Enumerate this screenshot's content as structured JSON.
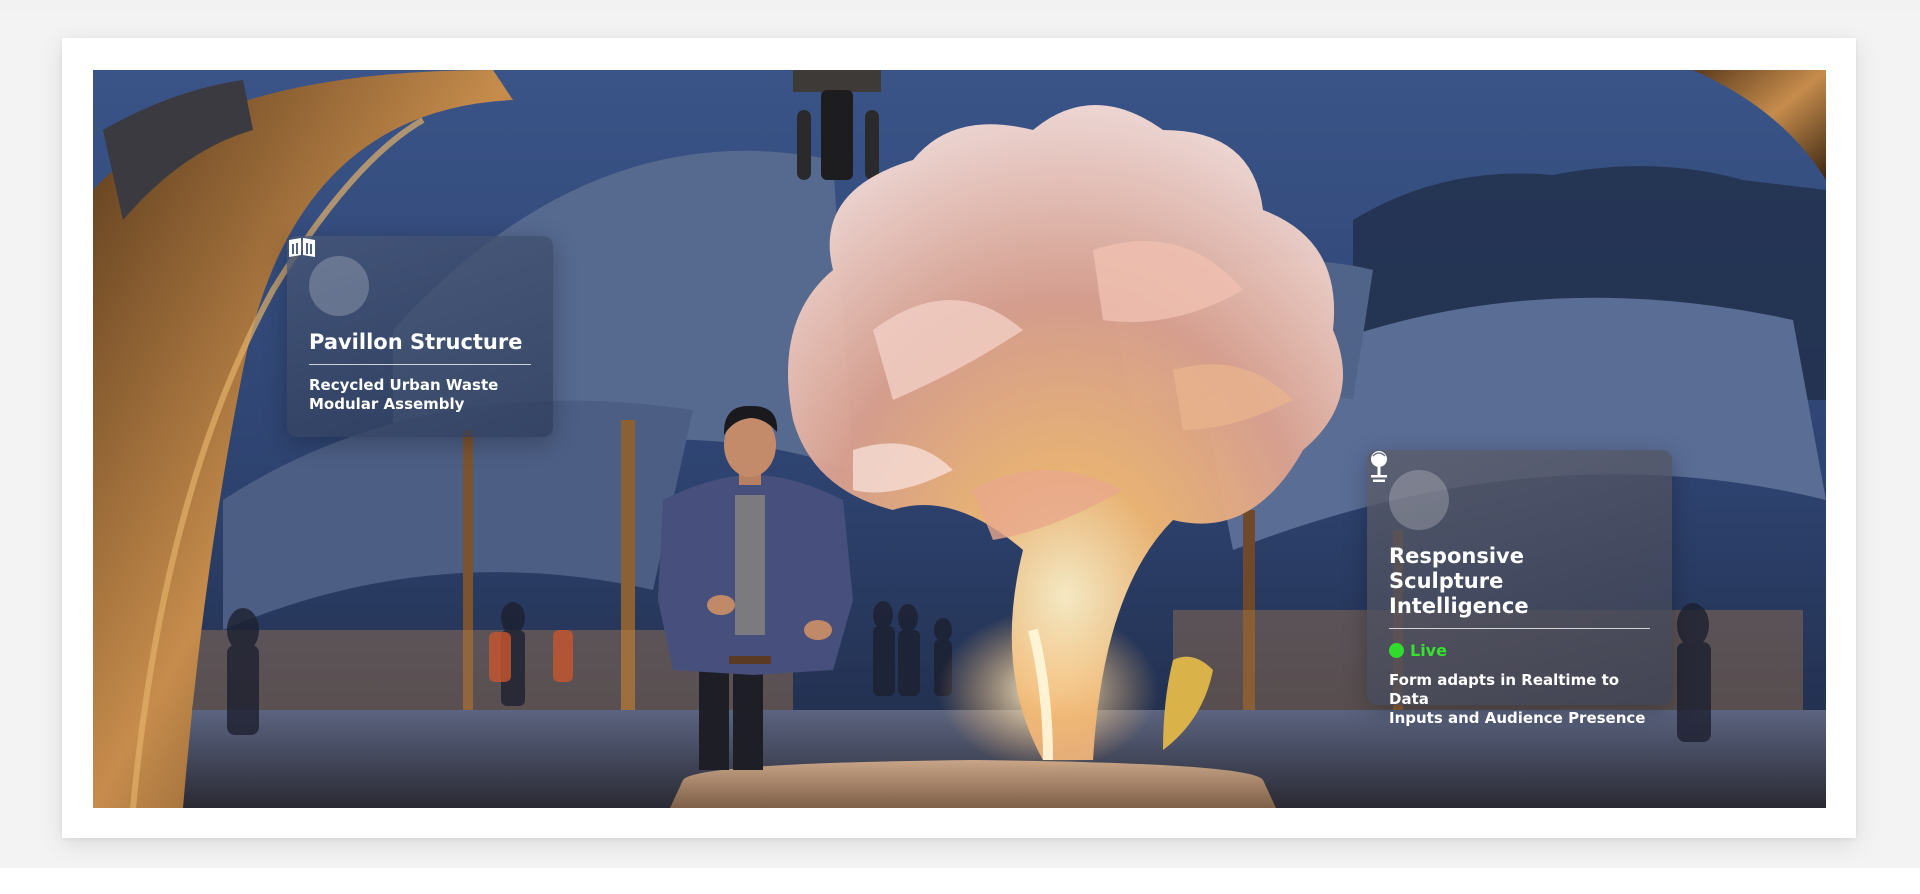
{
  "colors": {
    "page_background": "#f3f3f4",
    "frame": "#ffffff",
    "sky": "#2b3d62",
    "live_status": "#35e22e",
    "card_text": "#ffffff"
  },
  "hero_image": {
    "icon": "sculpture-scene-image"
  },
  "cards": {
    "pavilion": {
      "icon": "book-building-icon",
      "title": "Pavillon Structure",
      "description_line1": "Recycled Urban Waste",
      "description_line2": "Modular Assembly"
    },
    "sculpture": {
      "icon": "sculpture-pedestal-icon",
      "title_line1": "Responsive",
      "title_line2": "Sculpture Intelligence",
      "status": "Live",
      "description_line1": "Form adapts in Realtime to Data",
      "description_line2": "Inputs and Audience Presence"
    }
  }
}
